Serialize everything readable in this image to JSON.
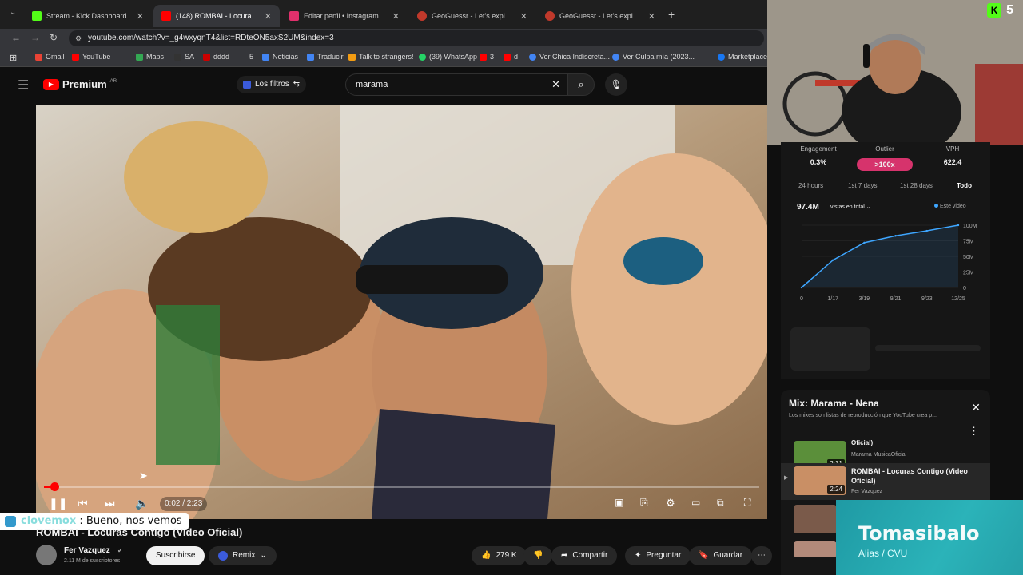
{
  "browser": {
    "tabs": [
      {
        "label": "Stream - Kick Dashboard",
        "color": "#53fc18"
      },
      {
        "label": "(148) ROMBAI - Locuras Co",
        "color": "#ff0000"
      },
      {
        "label": "Editar perfil • Instagram",
        "color": "#e1306c"
      },
      {
        "label": "GeoGuessr - Let's explore the w",
        "color": "#c0392b"
      },
      {
        "label": "GeoGuessr - Let's explore the w",
        "color": "#c0392b"
      }
    ],
    "url": "youtube.com/watch?v=_g4wxyqnT4&list=RDteON5axS2UM&index=3",
    "bookmarks": [
      "Gmail",
      "YouTube",
      "Maps",
      "SA",
      "dddd",
      "5",
      "Noticias",
      "Traducir",
      "Talk to strangers!",
      "(39) WhatsApp",
      "3",
      "d",
      "Ver Chica Indiscreta...",
      "Ver Culpa mía (2023...",
      "Marketplace"
    ]
  },
  "youtube": {
    "logo": "Premium",
    "logo_region": "AR",
    "filters_label": "Los filtros",
    "search_value": "marama"
  },
  "player": {
    "time": "0:02 / 2:23",
    "progress_fraction": 0.014
  },
  "video": {
    "title": "ROMBAI - Locuras Contigo (Video Oficial)",
    "channel": "Fer Vazquez",
    "subscribers": "2.11 M de suscriptores",
    "subscribe_label": "Suscribirse",
    "remix_label": "Remix",
    "likes": "279 K",
    "share_label": "Compartir",
    "ask_label": "Preguntar",
    "save_label": "Guardar"
  },
  "chat": {
    "user": "clovemox",
    "message": ": Bueno, nos vemos"
  },
  "stats": {
    "engagement_label": "Engagement",
    "engagement_value": "0.3%",
    "outlier_label": "Outlier",
    "outlier_value": ">100x",
    "vph_label": "VPH",
    "vph_value": "622.4",
    "ranges": [
      "24 hours",
      "1st 7 days",
      "1st 28 days",
      "Todo"
    ],
    "total_views": "97.4M",
    "views_dropdown": "vistas en total",
    "legend": "Este video"
  },
  "chart_data": {
    "type": "line",
    "x": [
      "0",
      "1/17",
      "3/19",
      "9/21",
      "9/23",
      "12/25"
    ],
    "series": [
      {
        "name": "Este video",
        "values": [
          0,
          44,
          72,
          83,
          91,
          100
        ]
      }
    ],
    "ylim": [
      0,
      100
    ],
    "yticks": [
      "0",
      "25M",
      "50M",
      "75M",
      "100M"
    ],
    "xlabel": "",
    "ylabel": "",
    "color": "#3ea6ff"
  },
  "mix": {
    "title": "Mix: Marama - Nena",
    "subtitle": "Los mixes son listas de reproducción que YouTube crea p...",
    "items": [
      {
        "title": "Oficial)",
        "channel": "Marama MusicaOficial",
        "duration": "2:31"
      },
      {
        "title": "ROMBAI - Locuras Contigo (Video Oficial)",
        "channel": "Fer Vazquez",
        "duration": "2:24"
      },
      {
        "title": "",
        "channel": "",
        "duration": ""
      },
      {
        "title": "",
        "channel": "",
        "duration": ""
      }
    ]
  },
  "overlay": {
    "donation_name": "Tomasibalo",
    "donation_sub": "Alias / CVU",
    "kick_count": "5"
  }
}
